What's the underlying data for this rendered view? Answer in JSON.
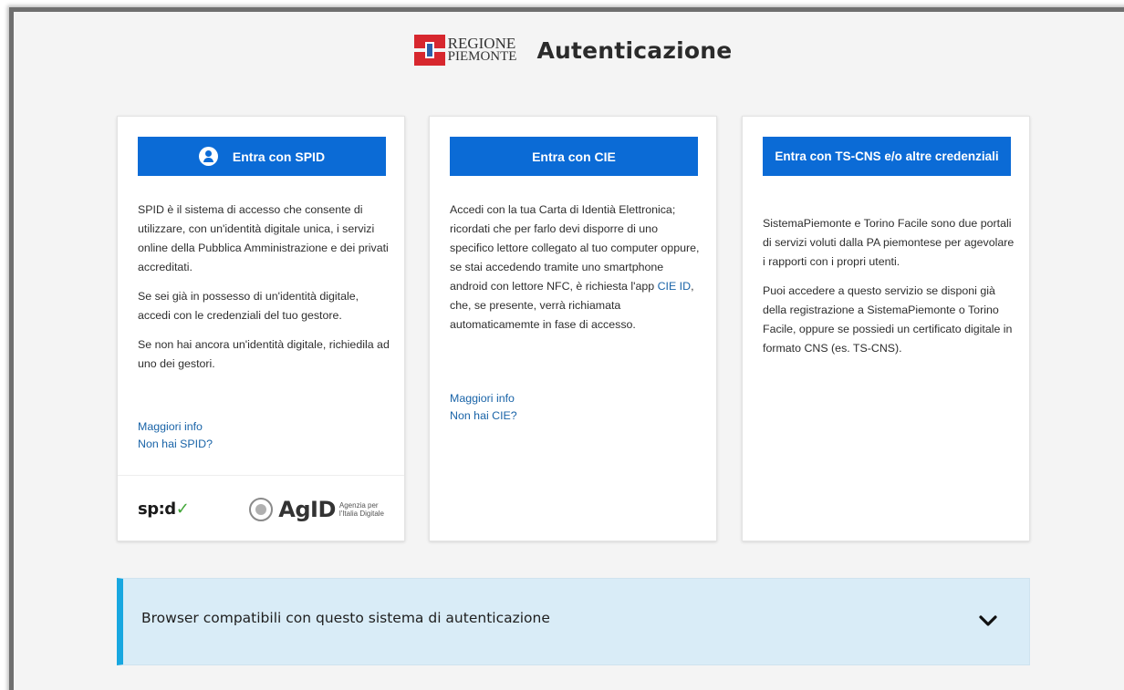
{
  "header": {
    "logo_line1": "REGIONE",
    "logo_line2": "PIEMONTE",
    "title": "Autenticazione"
  },
  "spid_card": {
    "button_label": "Entra con SPID",
    "paragraphs": [
      "SPID è il sistema di accesso che consente di utilizzare, con un'identità digitale unica, i servizi online della Pubblica Amministrazione e dei privati accreditati.",
      "Se sei già in possesso di un'identità digitale, accedi con le credenziali del tuo gestore.",
      "Se non hai ancora un'identità digitale, richiedila ad uno dei gestori."
    ],
    "link_more": "Maggiori info",
    "link_no": "Non hai SPID?",
    "spid_logo": "sp:d",
    "agid_logo": "AgID",
    "agid_sub1": "Agenzia per",
    "agid_sub2": "l'Italia Digitale"
  },
  "cie_card": {
    "button_label": "Entra con CIE",
    "text_before_link": "Accedi con la tua Carta di Identià Elettronica; ricordati che per farlo devi disporre di uno specifico lettore collegato al tuo computer oppure, se stai accedendo tramite uno smartphone android con lettore NFC, è richiesta l'app ",
    "inline_link": "CIE ID",
    "text_after_link": ", che, se presente, verrà richiamata automaticamemte in fase di accesso.",
    "link_more": "Maggiori info",
    "link_no": "Non hai CIE?"
  },
  "tscns_card": {
    "button_label": "Entra con TS-CNS e/o altre credenziali",
    "paragraphs": [
      "SistemaPiemonte e Torino Facile sono due portali di servizi voluti dalla PA piemontese per agevolare i rapporti con i propri utenti.",
      "Puoi accedere a questo servizio se disponi già della registrazione a SistemaPiemonte o Torino Facile, oppure se possiedi un certificato digitale in formato CNS (es. TS-CNS)."
    ]
  },
  "accordion": {
    "label": "Browser compatibili con questo sistema di autenticazione"
  },
  "colors": {
    "primary_button": "#0b6bd6",
    "link": "#1a64a8",
    "accordion_bg": "#d9ecf7",
    "accordion_accent": "#17a7e0",
    "spid_check": "#3fa535"
  }
}
